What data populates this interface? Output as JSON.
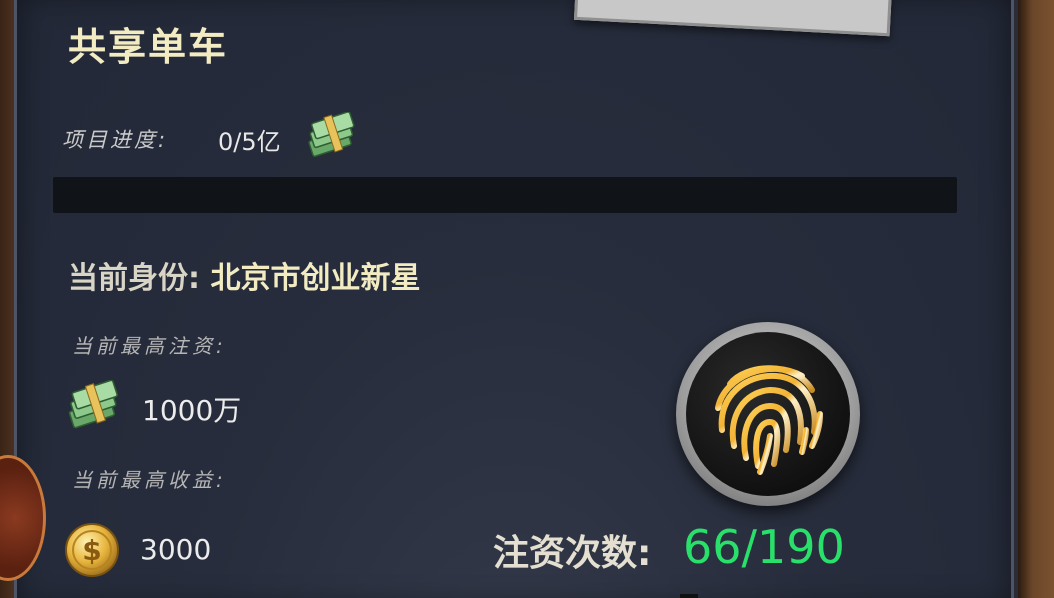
{
  "project": {
    "title": "共享单车",
    "progress_label": "项目进度:",
    "progress_value": "0/5亿",
    "progress_fraction": 0
  },
  "identity": {
    "label": "当前身份:",
    "value": "北京市创业新星"
  },
  "stats": {
    "max_investment_label": "当前最高注资:",
    "max_investment_value": "1000万",
    "max_income_label": "当前最高收益:",
    "max_income_value": "3000"
  },
  "invest": {
    "label": "注资次数:",
    "value": "66/190",
    "value_color": "#29e06a"
  },
  "icons": {
    "money": "cash-stack-icon",
    "coin": "dollar-coin-icon",
    "fingerprint": "fingerprint-icon"
  },
  "colors": {
    "title": "#f3ecc2",
    "accent_green": "#29e06a",
    "gold": "#e8b23a"
  }
}
